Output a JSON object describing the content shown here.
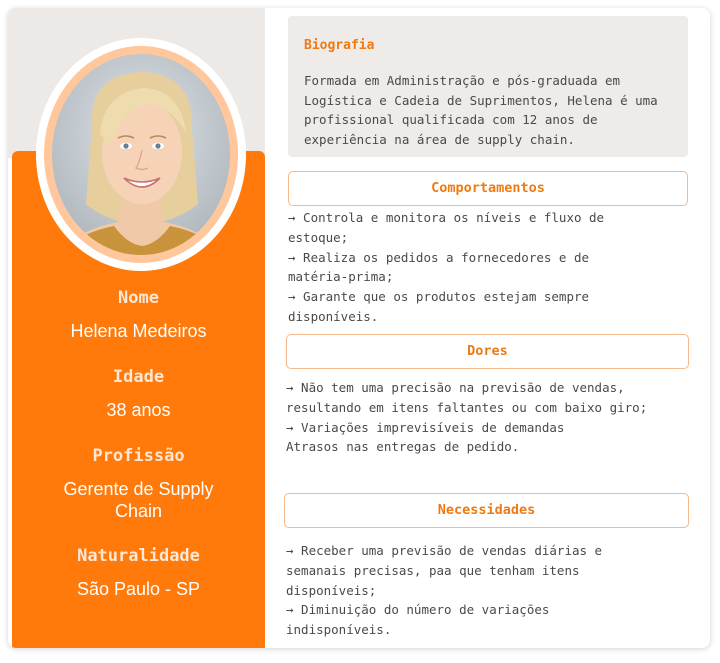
{
  "profile": {
    "photo_alt": "portrait-photo",
    "name_label": "Nome",
    "name_value": "Helena Medeiros",
    "age_label": "Idade",
    "age_value": "38 anos",
    "job_label": "Profissão",
    "job_value": "Gerente de Supply Chain",
    "origin_label": "Naturalidade",
    "origin_value": "São Paulo - SP"
  },
  "bio": {
    "title": "Biografia",
    "text": "Formada em Administração e pós-graduada em Logística e Cadeia de Suprimentos, Helena é uma profissional qualificada com 12 anos de experiência na área de supply chain."
  },
  "behaviors": {
    "title": "Comportamentos",
    "items": [
      "→ Controla e monitora os níveis e fluxo de estoque;",
      "→ Realiza os pedidos a fornecedores e de matéria-prima;",
      "→ Garante que os produtos estejam sempre disponíveis."
    ]
  },
  "pains": {
    "title": "Dores",
    "items": [
      "→ Não tem uma precisão na previsão de vendas, resultando em itens faltantes ou com baixo giro;",
      "→ Variações imprevisíveis de demandas",
      "Atrasos nas entregas de pedido."
    ]
  },
  "needs": {
    "title": "Necessidades",
    "items": [
      "→ Receber uma previsão de vendas diárias e semanais precisas, paa que tenham itens disponíveis;",
      "→ Diminuição do número de variações indisponíveis."
    ]
  },
  "colors": {
    "accent": "#ff7a0a",
    "title_text": "#f07a12",
    "panel_bg": "#eeebe8"
  }
}
